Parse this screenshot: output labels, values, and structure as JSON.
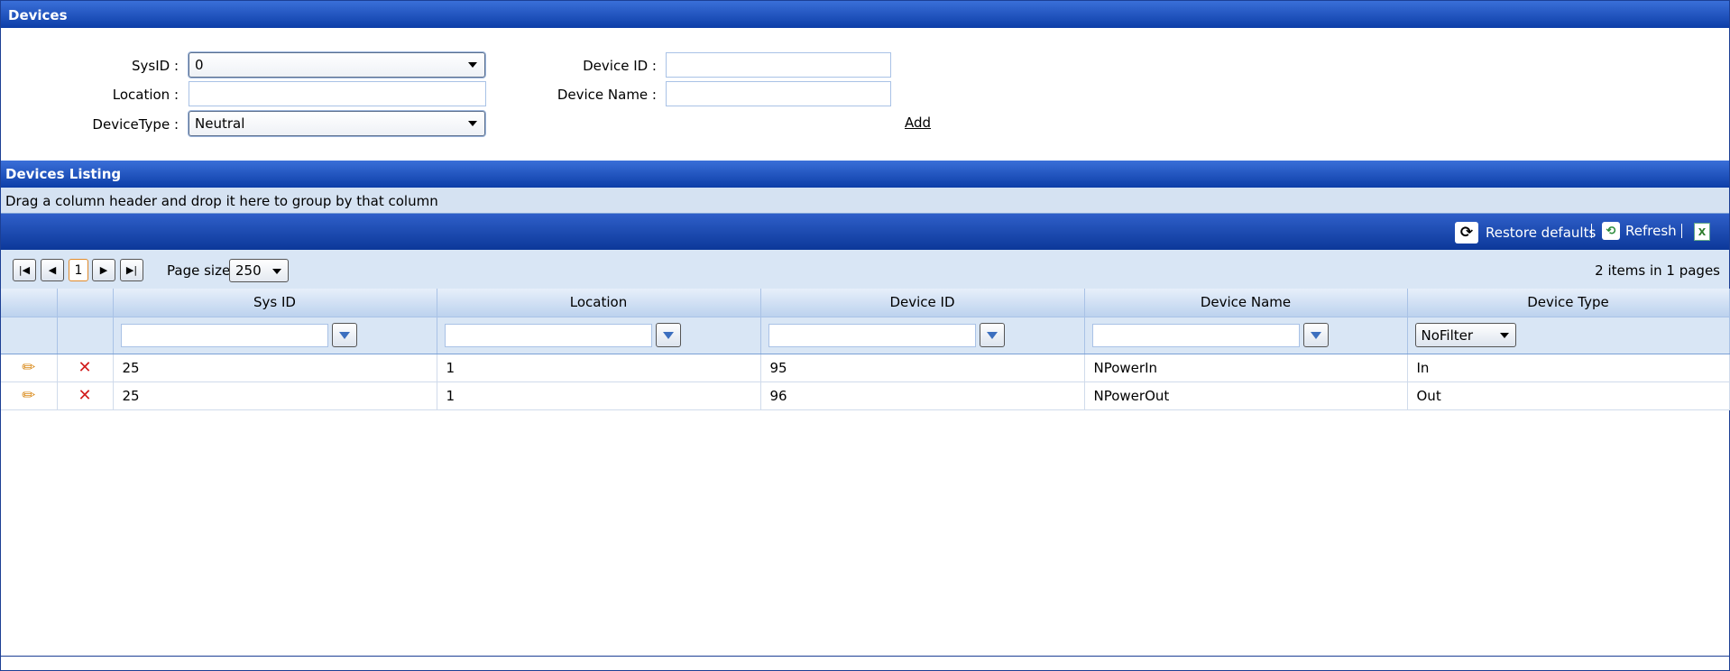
{
  "header": {
    "title": "Devices"
  },
  "form": {
    "sysid_label": "SysID :",
    "sysid_value": "0",
    "location_label": "Location :",
    "devicetype_label": "DeviceType :",
    "devicetype_value": "Neutral",
    "deviceid_label": "Device ID :",
    "devicename_label": "Device Name :",
    "add_label": "Add"
  },
  "listing": {
    "title": "Devices Listing",
    "group_hint": "Drag a column header and drop it here to group by that column",
    "restore_label": "Restore defaults",
    "refresh_label": "Refresh",
    "pager": {
      "current_page": "1",
      "page_size_label": "Page size:",
      "page_size_value": "250",
      "info": "2 items in 1 pages"
    },
    "columns": [
      "Sys ID",
      "Location",
      "Device ID",
      "Device Name",
      "Device Type"
    ],
    "type_filter": "NoFilter",
    "rows": [
      {
        "sys_id": "25",
        "location": "1",
        "device_id": "95",
        "device_name": "NPowerIn",
        "device_type": "In"
      },
      {
        "sys_id": "25",
        "location": "1",
        "device_id": "96",
        "device_name": "NPowerOut",
        "device_type": "Out"
      }
    ]
  },
  "colors": {
    "header_blue": "#0d3ea8",
    "panel_light": "#d9e6f5",
    "delete_red": "#d21c1c",
    "edit_orange": "#d98a1a"
  },
  "icons": [
    "refresh-icon",
    "export-excel-icon",
    "filter-icon",
    "edit-pencil-icon",
    "delete-icon",
    "first-page-icon",
    "prev-page-icon",
    "next-page-icon",
    "last-page-icon"
  ]
}
